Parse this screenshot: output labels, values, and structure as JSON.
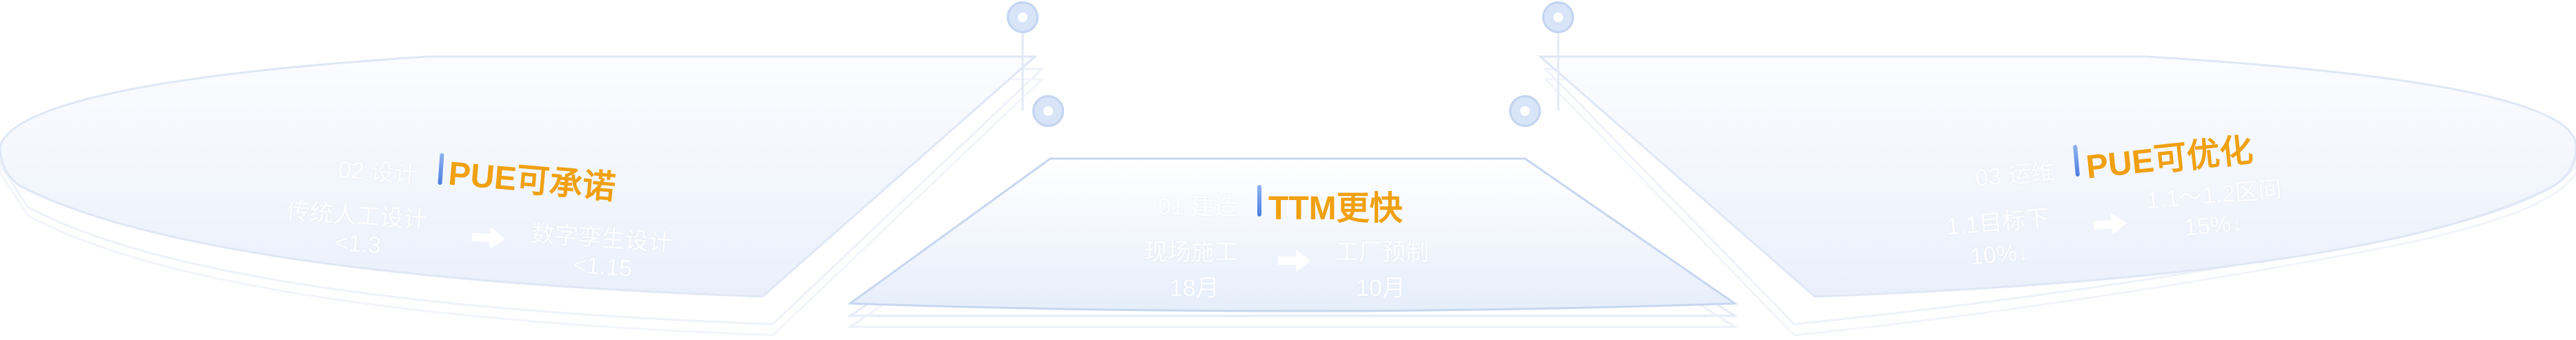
{
  "panels": [
    {
      "prefix": "02 设计",
      "headline": "PUE可承诺",
      "from_label": "传统人工设计",
      "from_value": "<1.3",
      "to_label": "数字孪生设计",
      "to_value": "<1.15"
    },
    {
      "prefix": "01 建造",
      "headline": "TTM更快",
      "from_label": "现场施工",
      "from_value": "18月",
      "to_label": "工厂预制",
      "to_value": "10月"
    },
    {
      "prefix": "03 运维",
      "headline": "PUE可优化",
      "from_label": "1.1目标下",
      "from_value": "10%↓",
      "to_label": "1.1～1.2区间",
      "to_value": "15%↓"
    }
  ],
  "colors": {
    "accent": "#f0a010",
    "panel_edge": "#c7d6f0",
    "node": "#d8e4f7"
  }
}
